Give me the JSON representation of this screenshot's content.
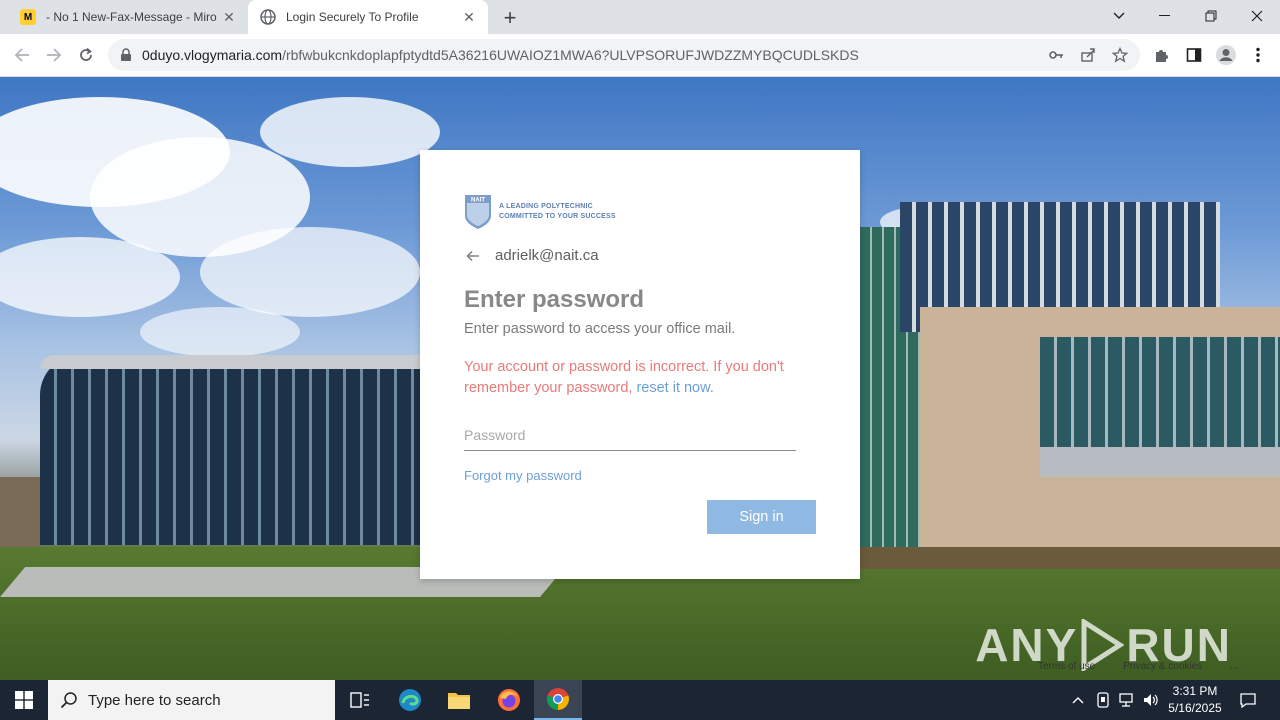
{
  "browser": {
    "tabs": [
      {
        "label": "- No 1 New-Fax-Message - Miro",
        "favicon": "miro-icon",
        "active": false
      },
      {
        "label": "Login Securely To Profile",
        "favicon": "globe-icon",
        "active": true
      }
    ],
    "address": {
      "host": "0duyo.vlogymaria.com",
      "path": "/rbfwbukcnkdoplapfptydtd5A36216UWAIOZ1MWA6?ULVPSORUFJWDZZMYBQCUDLSKDS"
    }
  },
  "login": {
    "logo_line1": "A LEADING POLYTECHNIC",
    "logo_line2": "COMMITTED TO YOUR SUCCESS",
    "logo_badge": "NAIT",
    "email": "adrielk@nait.ca",
    "heading": "Enter password",
    "subtitle": "Enter password to access your office mail.",
    "error_text": "Your account or password is incorrect. If you don't remember your password, ",
    "error_link": "reset it now.",
    "password_placeholder": "Password",
    "forgot_link": "Forgot my password",
    "signin_label": "Sign in"
  },
  "page_footer": {
    "terms": "Terms of use",
    "privacy": "Privacy & cookies",
    "more": "..."
  },
  "watermark": {
    "left": "ANY",
    "right": "RUN"
  },
  "taskbar": {
    "search_placeholder": "Type here to search",
    "time": "3:31 PM",
    "date": "5/16/2025"
  },
  "colors": {
    "error": "#e87a7a",
    "link": "#6d9fd8",
    "signin_button": "#8fb9e3",
    "taskbar": "#1c2533"
  }
}
